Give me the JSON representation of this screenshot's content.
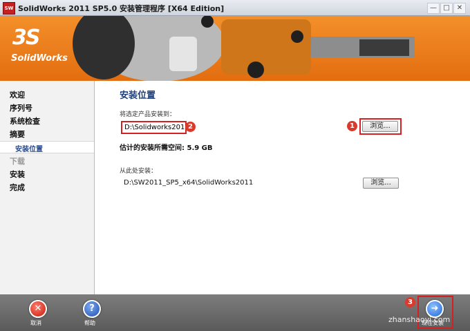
{
  "window": {
    "title": "SolidWorks 2011 SP5.0 安装管理程序 [X64 Edition]",
    "app_icon_text": "SW",
    "minimize": "—",
    "maximize": "□",
    "close": "✕"
  },
  "banner": {
    "logo_mark": "3S",
    "logo_text": "SolidWorks"
  },
  "sidebar": {
    "items": [
      {
        "label": "欢迎"
      },
      {
        "label": "序列号"
      },
      {
        "label": "系统检查"
      },
      {
        "label": "摘要"
      },
      {
        "label": "安装位置"
      },
      {
        "label": "下载"
      },
      {
        "label": "安装"
      },
      {
        "label": "完成"
      }
    ]
  },
  "main": {
    "title": "安装位置",
    "install_to_label": "将选定产品安装到：",
    "install_path": "D:\\Solidworks2011",
    "browse_label": "浏览...",
    "space_text": "估计的安装所需空间: 5.9 GB",
    "source_label": "从此处安装：",
    "source_path": "D:\\SW2011_SP5_x64\\SolidWorks2011",
    "browse2_label": "浏览..."
  },
  "annotations": {
    "badge1": "1",
    "badge2": "2",
    "badge3": "3"
  },
  "bottom": {
    "cancel_label": "取消",
    "help_label": "帮助",
    "next_label": "现在安装",
    "watermark": "zhanshaoyi.com"
  }
}
